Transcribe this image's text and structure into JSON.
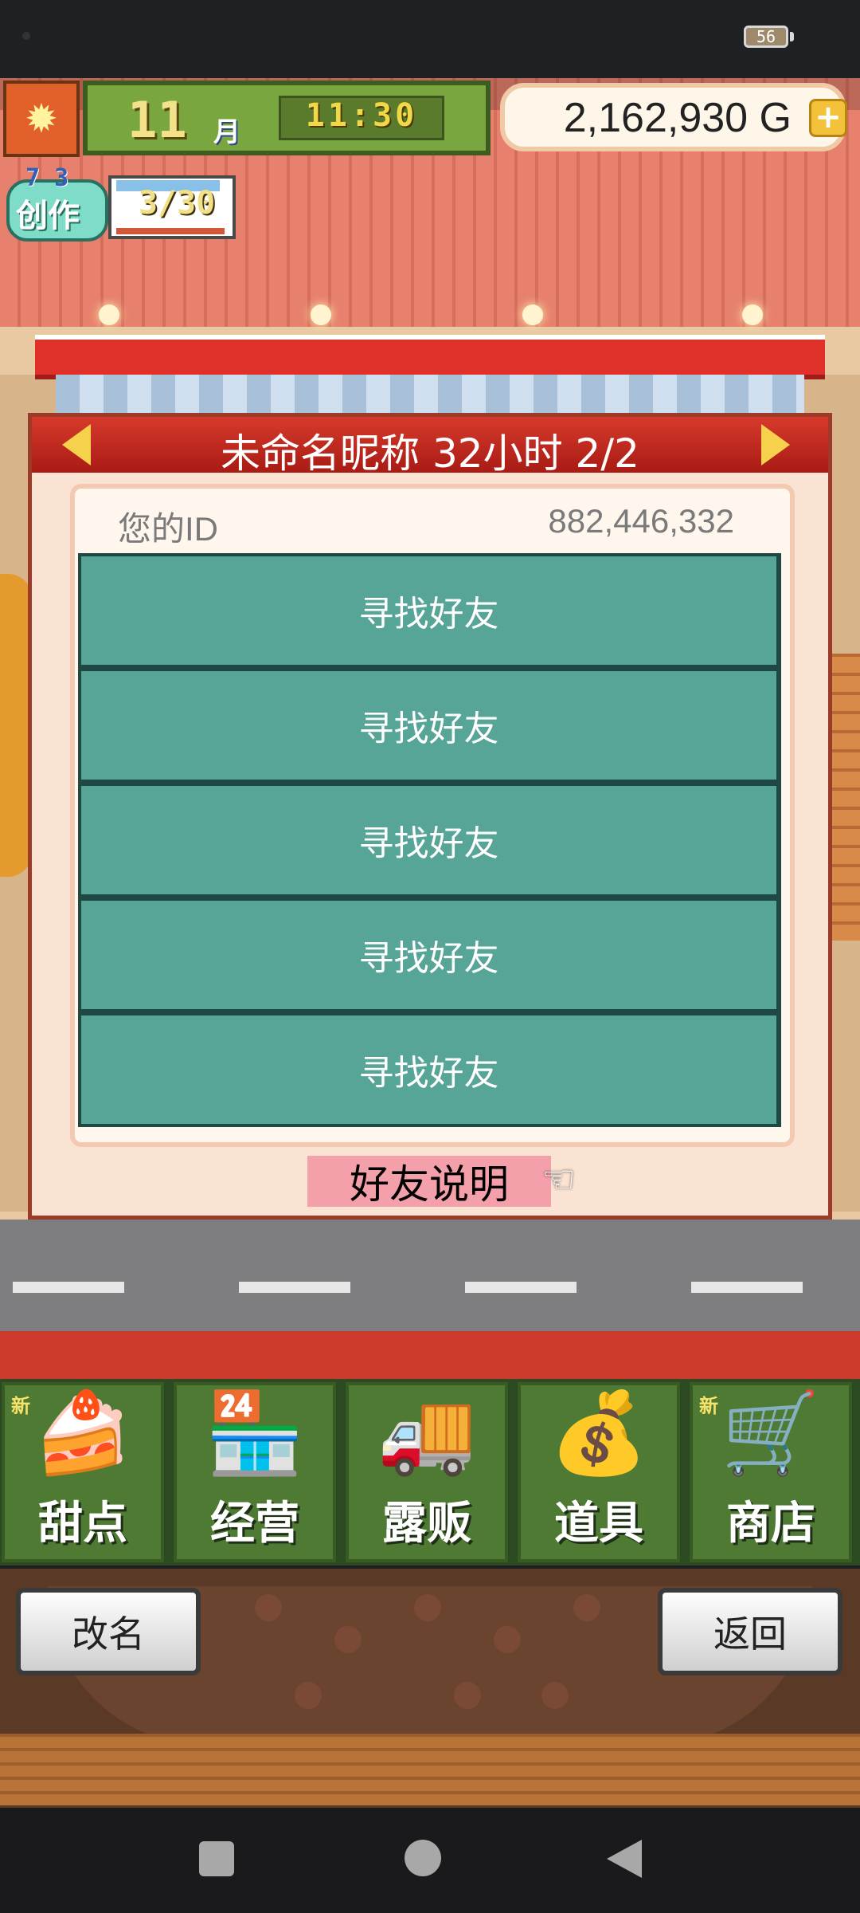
{
  "status_bar": {
    "battery": "56"
  },
  "hud": {
    "month_number": "11",
    "month_unit": "月",
    "time": "11:30",
    "gold": "2,162,930 G",
    "gold_plus_icon": "plus-icon",
    "create_label": "创作",
    "create_level": "7 3",
    "create_count": "3/30"
  },
  "dialog": {
    "title": "未命名昵称  32小时 2/2",
    "id_label": "您的ID",
    "id_value": "882,446,332",
    "slots": [
      "寻找好友",
      "寻找好友",
      "寻找好友",
      "寻找好友",
      "寻找好友"
    ],
    "help_label": "好友说明",
    "help_icon": "pointing-hand-icon"
  },
  "menu": {
    "items": [
      {
        "label": "甜点",
        "new": "新",
        "icon": "cake-icon",
        "glyph": "🍰"
      },
      {
        "label": "经营",
        "new": "",
        "icon": "shop-icon",
        "glyph": "🏪"
      },
      {
        "label": "露贩",
        "new": "",
        "icon": "food-truck-icon",
        "glyph": "🚚"
      },
      {
        "label": "道具",
        "new": "",
        "icon": "item-bag-icon",
        "glyph": "💰"
      },
      {
        "label": "商店",
        "new": "新",
        "icon": "cart-icon",
        "glyph": "🛒"
      }
    ]
  },
  "footer": {
    "rename_label": "改名",
    "back_label": "返回"
  }
}
